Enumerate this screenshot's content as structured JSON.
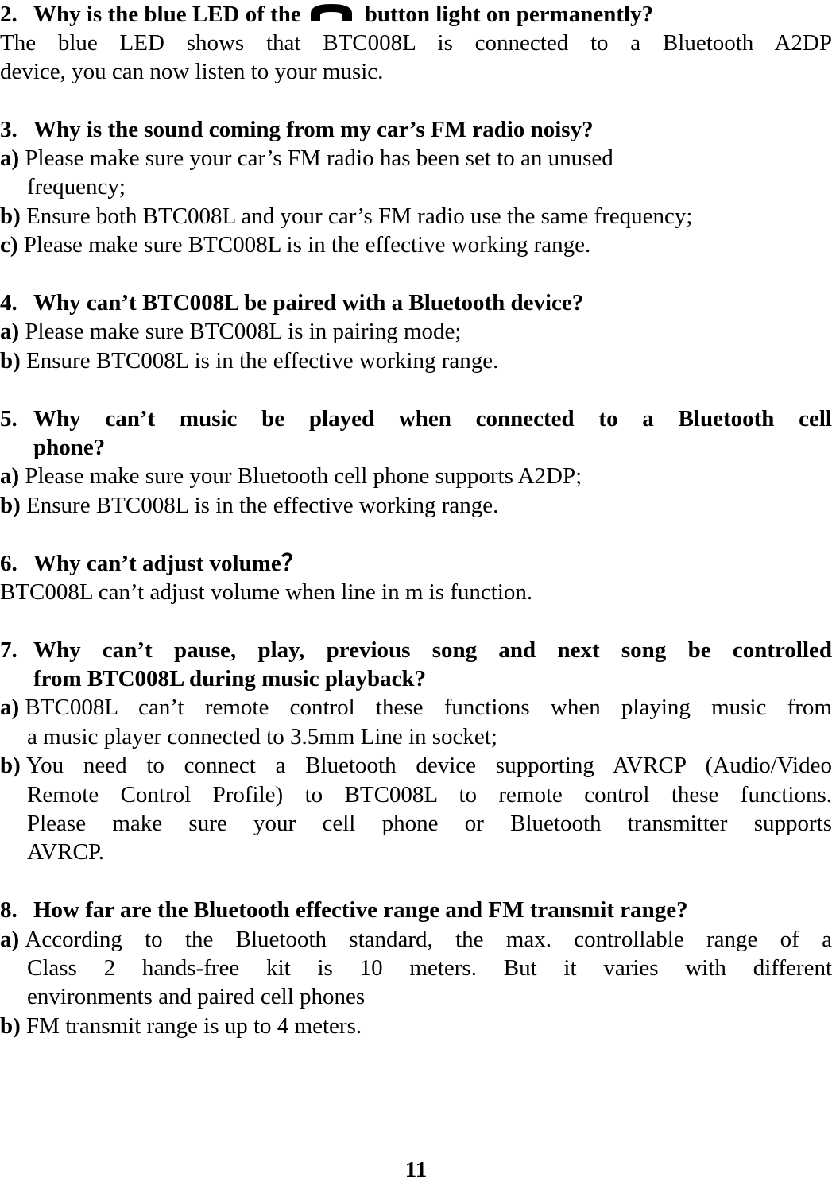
{
  "faq": [
    {
      "number": "2.",
      "question_before_icon": "Why is the blue LED of the",
      "icon": "phone-handset-icon",
      "question_after_icon": "button light on permanently?",
      "answer_lines": [
        "The blue LED shows that BTC008L is connected to a Bluetooth A2DP",
        "device, you can now listen to your music."
      ]
    },
    {
      "number": "3.",
      "question": "Why is the sound coming from my car’s FM radio noisy?",
      "items": [
        {
          "label": "a)",
          "lines": [
            "Please make sure your car’s FM radio has been set to an unused",
            "frequency;"
          ]
        },
        {
          "label": "b)",
          "lines": [
            "Ensure both BTC008L and your car’s FM radio use the same frequency;"
          ]
        },
        {
          "label": "c)",
          "lines": [
            "Please make sure BTC008L is in the effective working range."
          ]
        }
      ]
    },
    {
      "number": "4.",
      "question": "Why can’t BTC008L be paired with a Bluetooth device?",
      "items": [
        {
          "label": "a)",
          "lines": [
            "Please make sure BTC008L is in pairing mode;"
          ]
        },
        {
          "label": "b)",
          "lines": [
            "Ensure BTC008L is in the effective working range."
          ]
        }
      ]
    },
    {
      "number": "5.",
      "question_lines": [
        "Why can’t music be played when connected to a Bluetooth cell",
        "phone?"
      ],
      "items": [
        {
          "label": "a)",
          "lines": [
            "Please make sure your Bluetooth cell phone supports A2DP;"
          ]
        },
        {
          "label": "b)",
          "lines": [
            "Ensure BTC008L is in the effective working range."
          ]
        }
      ]
    },
    {
      "number": "6.",
      "question": "Why can’t adjust volume？",
      "answer_lines": [
        "BTC008L can’t adjust volume when line in m is function."
      ]
    },
    {
      "number": "7.",
      "question_lines": [
        "Why can’t pause, play, previous song and next song be controlled",
        "from BTC008L during music playback?"
      ],
      "items": [
        {
          "label": "a)",
          "lines": [
            "BTC008L can’t remote control these functions when playing music from",
            "a music player connected to 3.5mm Line in socket;"
          ]
        },
        {
          "label": "b)",
          "lines": [
            "You need to connect a Bluetooth device supporting AVRCP (Audio/Video",
            "Remote Control Profile) to BTC008L to remote control these functions.",
            "Please make sure your cell phone or Bluetooth transmitter supports",
            "AVRCP."
          ]
        }
      ]
    },
    {
      "number": "8.",
      "question": "How far are the Bluetooth effective range and FM transmit range?",
      "items": [
        {
          "label": "a)",
          "lines": [
            "According to the Bluetooth standard, the max. controllable range of a",
            "Class 2 hands-free kit is 10 meters. But it varies with different",
            "environments and paired cell phones"
          ]
        },
        {
          "label": "b)",
          "lines": [
            "FM transmit range is up to 4 meters."
          ]
        }
      ]
    }
  ],
  "page_number": "11"
}
